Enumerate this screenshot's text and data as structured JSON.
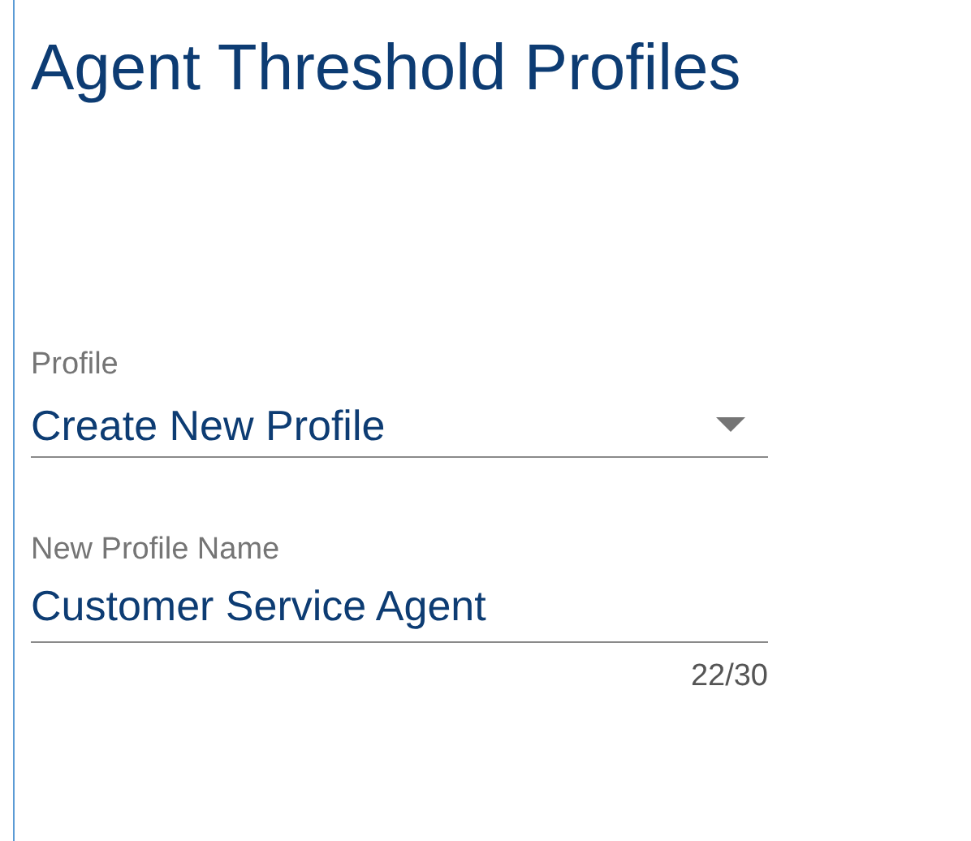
{
  "title": "Agent Threshold Profiles",
  "profile_select": {
    "label": "Profile",
    "value": "Create New Profile"
  },
  "name_field": {
    "label": "New Profile Name",
    "value": "Customer Service Agent",
    "counter": "22/30"
  }
}
